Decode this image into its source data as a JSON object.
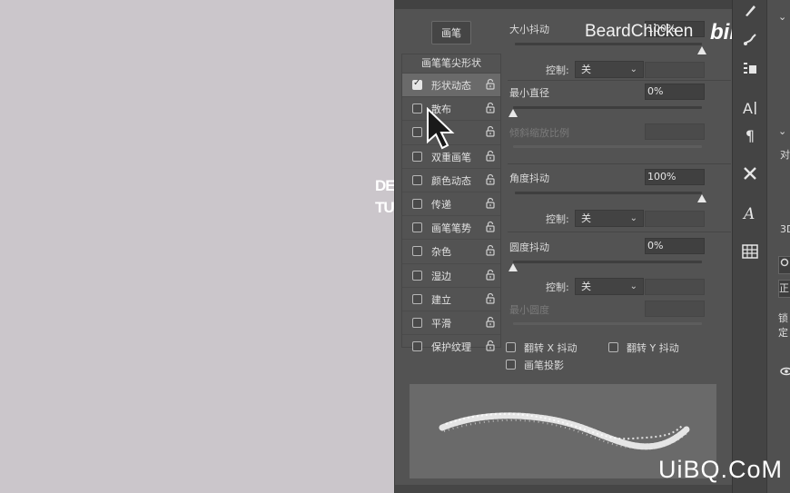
{
  "canvas": {
    "text_line1": "DE",
    "text_line2": "TU"
  },
  "brush_panel": {
    "brush_button": "画笔",
    "list_header": "画笔笔尖形状",
    "items": [
      {
        "label": "形状动态",
        "checked": true,
        "active": true
      },
      {
        "label": "散布",
        "checked": false,
        "active": false
      },
      {
        "label": "",
        "checked": false,
        "active": false
      },
      {
        "label": "双重画笔",
        "checked": false,
        "active": false
      },
      {
        "label": "颜色动态",
        "checked": false,
        "active": false
      },
      {
        "label": "传递",
        "checked": false,
        "active": false
      },
      {
        "label": "画笔笔势",
        "checked": false,
        "active": false
      },
      {
        "label": "杂色",
        "checked": false,
        "active": false
      },
      {
        "label": "湿边",
        "checked": false,
        "active": false
      },
      {
        "label": "建立",
        "checked": false,
        "active": false
      },
      {
        "label": "平滑",
        "checked": false,
        "active": false
      },
      {
        "label": "保护纹理",
        "checked": false,
        "active": false
      }
    ],
    "settings": {
      "size_jitter_label": "大小抖动",
      "size_jitter_value": "100%",
      "size_jitter_level": 1.0,
      "control_label": "控制:",
      "control_value": "关",
      "min_diameter_label": "最小直径",
      "min_diameter_value": "0%",
      "min_diameter_level": 0.0,
      "tilt_scale_label": "倾斜缩放比例",
      "angle_jitter_label": "角度抖动",
      "angle_jitter_value": "100%",
      "angle_jitter_level": 1.0,
      "control2_label": "控制:",
      "control2_value": "关",
      "roundness_jitter_label": "圆度抖动",
      "roundness_jitter_value": "0%",
      "roundness_jitter_level": 0.0,
      "control3_label": "控制:",
      "control3_value": "关",
      "min_roundness_label": "最小圆度",
      "flip_x_label": "翻转 X 抖动",
      "flip_y_label": "翻转 Y 抖动",
      "brush_projection_label": "画笔投影"
    }
  },
  "far_right": {
    "item1": "对",
    "item2": "3D",
    "item3": "正",
    "item4": "锁定"
  },
  "watermarks": {
    "credit": "BeardChicken",
    "bilibili": "bilibili",
    "site": "UiBQ.CoM"
  },
  "colors": {
    "panel": "#535353",
    "toolbar": "#444444",
    "canvas": "#cbc6cb"
  }
}
